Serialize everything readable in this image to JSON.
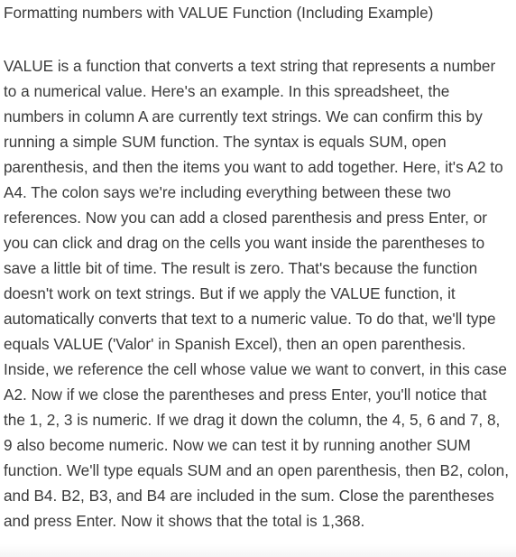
{
  "article": {
    "title": "Formatting numbers with VALUE Function (Including Example)",
    "body": "VALUE is a function that converts a text string that represents a number to a numerical value. Here's an example. In this spreadsheet, the numbers in column A are currently text strings. We can confirm this by running a simple SUM function. The syntax is equals SUM, open parenthesis, and then the items you want to add together. Here, it's A2 to A4. The colon says we're including everything between these two references. Now you can add a closed parenthesis and press Enter, or you can click and drag on the cells you want inside the parentheses to save a little bit of time. The result is zero. That's because the function doesn't work on text strings. But if we apply the VALUE function, it automatically converts that text to a numeric value. To do that, we'll type equals VALUE ('Valor' in Spanish Excel), then an open parenthesis. Inside, we reference the cell whose value we want to convert, in this case A2. Now if we close the parentheses and press Enter, you'll notice that the 1, 2, 3 is numeric. If we drag it down the column, the 4, 5, 6 and 7, 8, 9 also become numeric. Now we can test it by running another SUM function. We'll type equals SUM and an open parenthesis, then B2, colon, and B4. B2, B3, and B4 are included in the sum. Close the parentheses and press Enter. Now it shows that the total is 1,368."
  }
}
